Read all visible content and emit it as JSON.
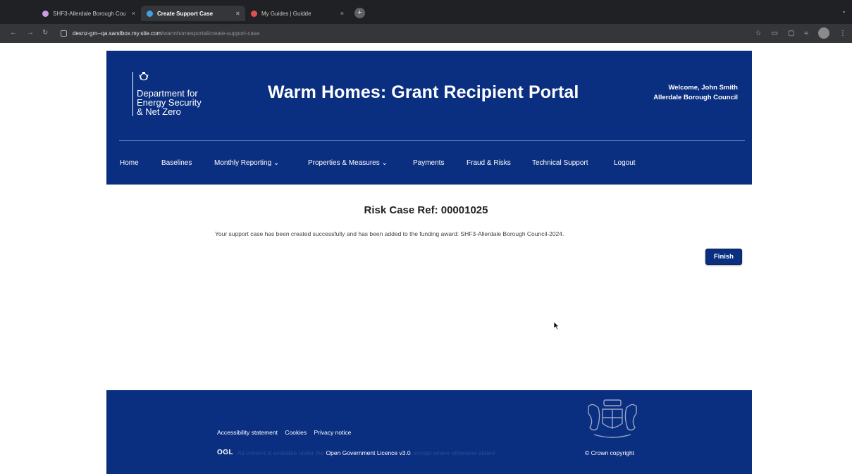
{
  "browser": {
    "tabs": [
      {
        "title": "SHF3-Allerdale Borough Cou",
        "active": false,
        "favicon_color": "#c89ee6"
      },
      {
        "title": "Create Support Case",
        "active": true,
        "favicon_color": "#3da3e6"
      },
      {
        "title": "My Guides | Guidde",
        "active": false,
        "favicon_color": "#e05050"
      }
    ],
    "new_tab_label": "+",
    "url_host": "desnz-gm--qa.sandbox.my.site.com",
    "url_path": "/warmhomesportal/create-support-case"
  },
  "header": {
    "dept_name": [
      "Department for",
      "Energy Security",
      "& Net Zero"
    ],
    "portal_title": "Warm Homes: Grant Recipient Portal",
    "welcome": "Welcome, John Smith",
    "organisation": "Allerdale Borough Council"
  },
  "nav": [
    {
      "label": "Home"
    },
    {
      "label": "Baselines"
    },
    {
      "label": "Monthly Reporting ⌄"
    },
    {
      "label": "Properties & Measures ⌄"
    },
    {
      "label": "Payments"
    },
    {
      "label": "Fraud & Risks"
    },
    {
      "label": "Technical Support"
    },
    {
      "label": "Logout"
    }
  ],
  "main": {
    "ref_title": "Risk Case Ref: 00001025",
    "message": "Your support case has been created successfully and has been added to the funding award: SHF3-Allerdale Borough Council-2024.",
    "finish_label": "Finish"
  },
  "footer": {
    "links": [
      "Accessibility statement",
      "Cookies",
      "Privacy notice"
    ],
    "ogl_logo": "OGL",
    "licence_prefix": "All content is available under the",
    "licence_link": "Open Government Licence v3.0",
    "licence_suffix": ", except where otherwise stated",
    "copyright": "© Crown copyright"
  },
  "colors": {
    "brand_blue": "#0b2f80",
    "chrome_dark": "#202124",
    "chrome_toolbar": "#35363a"
  }
}
